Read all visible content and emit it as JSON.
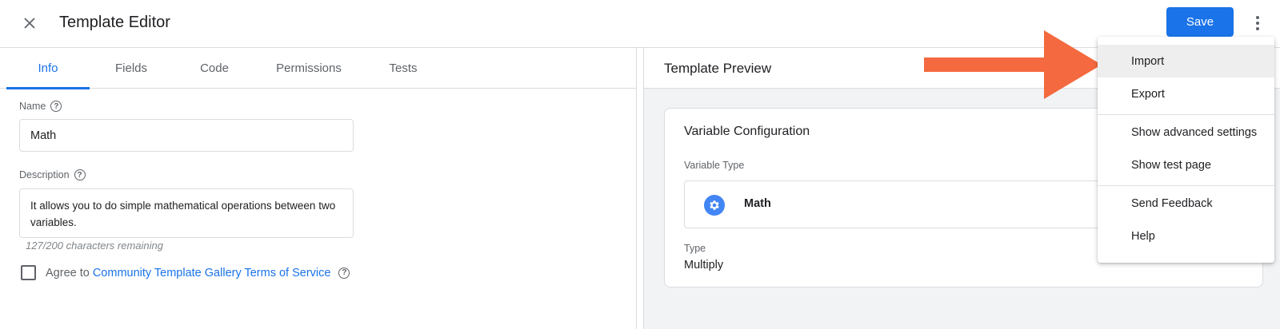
{
  "header": {
    "close_icon": "close-icon",
    "title": "Template Editor",
    "save_label": "Save",
    "more_icon": "more-vert-icon"
  },
  "tabs": [
    {
      "label": "Info",
      "active": true
    },
    {
      "label": "Fields",
      "active": false
    },
    {
      "label": "Code",
      "active": false
    },
    {
      "label": "Permissions",
      "active": false
    },
    {
      "label": "Tests",
      "active": false
    }
  ],
  "info": {
    "name_label": "Name",
    "name_value": "Math",
    "description_label": "Description",
    "description_value": "It allows you to do simple mathematical operations between two variables.",
    "chars_remaining": "127/200 characters remaining",
    "agree_prefix": "Agree to",
    "agree_link": "Community Template Gallery Terms of Service",
    "agree_checked": false,
    "help_icon": "help-icon"
  },
  "preview": {
    "title": "Template Preview",
    "card_title": "Variable Configuration",
    "variable_type_label": "Variable Type",
    "variable_type_value": "Math",
    "variable_type_icon": "gear-icon",
    "type_label": "Type",
    "type_value": "Multiply"
  },
  "menu": {
    "items": [
      {
        "label": "Import",
        "highlighted": true
      },
      {
        "label": "Export",
        "highlighted": false
      },
      {
        "label": "Show advanced settings",
        "highlighted": false
      },
      {
        "label": "Show test page",
        "highlighted": false
      },
      {
        "label": "Send Feedback",
        "highlighted": false
      },
      {
        "label": "Help",
        "highlighted": false
      }
    ]
  },
  "colors": {
    "accent": "#1a73e8",
    "arrow": "#f4693f",
    "gear": "#4285f4"
  }
}
